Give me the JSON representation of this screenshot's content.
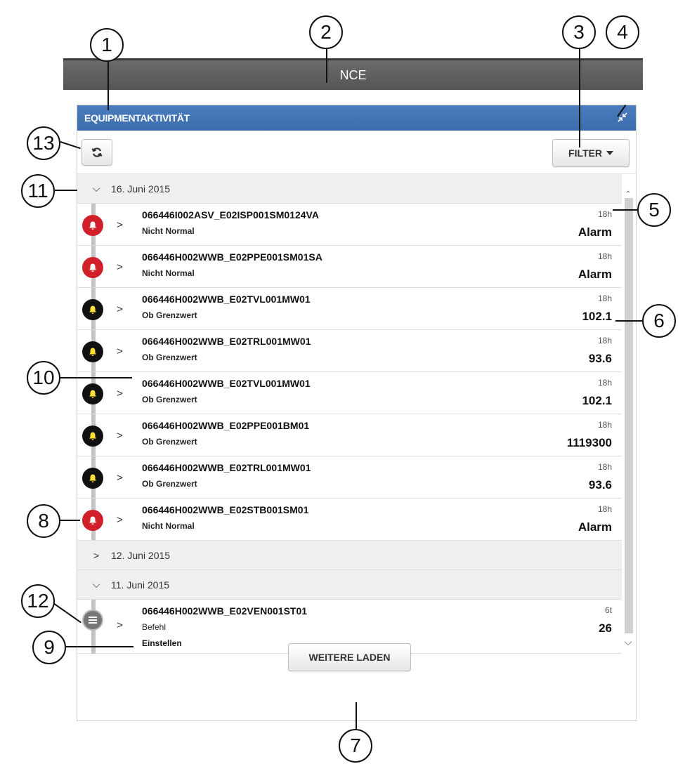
{
  "topbar": {
    "title": "NCE"
  },
  "widget": {
    "title": "EQUIPMENTAKTIVITÄT",
    "filter_label": "FILTER",
    "load_more_label": "WEITERE LADEN"
  },
  "groups": [
    {
      "date": "16. Juni 2015",
      "expanded": true,
      "entries": [
        {
          "name": "066446I002ASV_E02ISP001SM0124VA",
          "status": "Nicht Normal",
          "time": "18h",
          "value": "Alarm",
          "icon": "bell-icon",
          "color": "red"
        },
        {
          "name": "066446H002WWB_E02PPE001SM01SA",
          "status": "Nicht Normal",
          "time": "18h",
          "value": "Alarm",
          "icon": "bell-icon",
          "color": "red"
        },
        {
          "name": "066446H002WWB_E02TVL001MW01",
          "status": "Ob Grenzwert",
          "time": "18h",
          "value": "102.1",
          "icon": "bell-icon",
          "color": "black"
        },
        {
          "name": "066446H002WWB_E02TRL001MW01",
          "status": "Ob Grenzwert",
          "time": "18h",
          "value": "93.6",
          "icon": "bell-icon",
          "color": "black"
        },
        {
          "name": "066446H002WWB_E02TVL001MW01",
          "status": "Ob Grenzwert",
          "time": "18h",
          "value": "102.1",
          "icon": "bell-icon",
          "color": "black"
        },
        {
          "name": "066446H002WWB_E02PPE001BM01",
          "status": "Ob Grenzwert",
          "time": "18h",
          "value": "1119300",
          "icon": "bell-icon",
          "color": "black"
        },
        {
          "name": "066446H002WWB_E02TRL001MW01",
          "status": "Ob Grenzwert",
          "time": "18h",
          "value": "93.6",
          "icon": "bell-icon",
          "color": "black"
        },
        {
          "name": "066446H002WWB_E02STB001SM01",
          "status": "Nicht Normal",
          "time": "18h",
          "value": "Alarm",
          "icon": "bell-icon",
          "color": "red"
        }
      ]
    },
    {
      "date": "12. Juni 2015",
      "expanded": false
    },
    {
      "date": "11. Juni 2015",
      "expanded": true,
      "entries": [
        {
          "name": "066446H002WWB_E02VEN001ST01",
          "status": "Befehl",
          "detail": "Einstellen",
          "time": "6t",
          "value": "26",
          "icon": "command-list-icon",
          "color": "grey"
        }
      ]
    }
  ],
  "callouts": [
    "1",
    "2",
    "3",
    "4",
    "5",
    "6",
    "7",
    "8",
    "9",
    "10",
    "11",
    "12",
    "13"
  ],
  "colors": {
    "header_blue": "#3b6cab",
    "topbar_grey": "#5e5e5e",
    "alarm_red": "#d1202a",
    "limit_black": "#111111",
    "bell_yellow": "#ffe033"
  }
}
